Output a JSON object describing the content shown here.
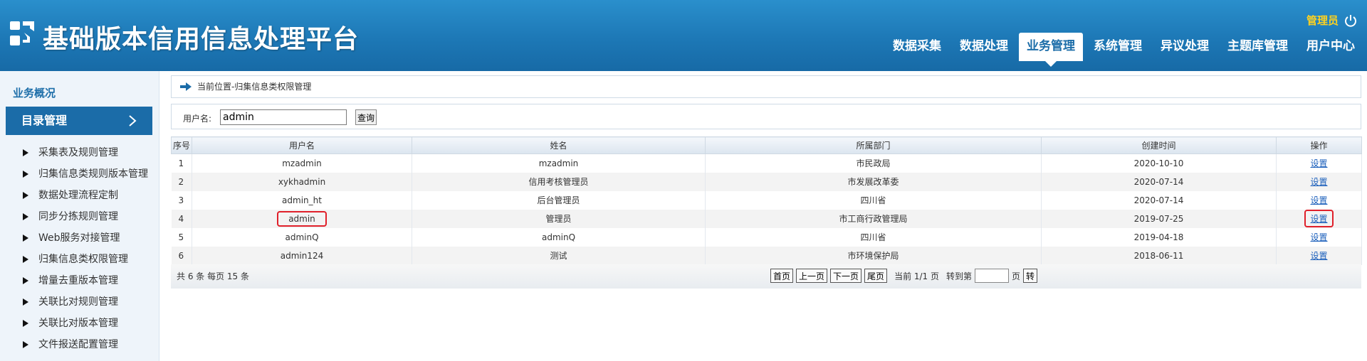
{
  "header": {
    "title": "基础版本信用信息处理平台",
    "user": "管理员",
    "nav": [
      "数据采集",
      "数据处理",
      "业务管理",
      "系统管理",
      "异议处理",
      "主题库管理",
      "用户中心"
    ],
    "active_nav": "业务管理"
  },
  "sidebar": {
    "overview": "业务概况",
    "active": "目录管理",
    "items": [
      "采集表及规则管理",
      "归集信息类规则版本管理",
      "数据处理流程定制",
      "同步分拣规则管理",
      "Web服务对接管理",
      "归集信息类权限管理",
      "增量去重版本管理",
      "关联比对规则管理",
      "关联比对版本管理",
      "文件报送配置管理"
    ]
  },
  "breadcrumb": "当前位置-归集信息类权限管理",
  "search": {
    "label": "用户名:",
    "value": "admin",
    "button": "查询"
  },
  "table": {
    "headers": [
      "序号",
      "用户名",
      "姓名",
      "所属部门",
      "创建时间",
      "操作"
    ],
    "rows": [
      [
        "1",
        "mzadmin",
        "mzadmin",
        "市民政局",
        "2020-10-10",
        "设置"
      ],
      [
        "2",
        "xykhadmin",
        "信用考核管理员",
        "市发展改革委",
        "2020-07-14",
        "设置"
      ],
      [
        "3",
        "admin_ht",
        "后台管理员",
        "四川省",
        "2020-07-14",
        "设置"
      ],
      [
        "4",
        "admin",
        "管理员",
        "市工商行政管理局",
        "2019-07-25",
        "设置"
      ],
      [
        "5",
        "adminQ",
        "adminQ",
        "四川省",
        "2019-04-18",
        "设置"
      ],
      [
        "6",
        "admin124",
        "测试",
        "市环境保护局",
        "2018-06-11",
        "设置"
      ]
    ]
  },
  "pager": {
    "summary": "共 6 条  每页  15  条",
    "first": "首页",
    "prev": "上一页",
    "next": "下一页",
    "last": "尾页",
    "current": "当前 1/1 页",
    "goto": "转到第",
    "page_unit": "页",
    "go": "转"
  },
  "colors": {
    "header": "#1d78b6",
    "accent": "#1b6ca8",
    "user": "#ffd21f",
    "highlight": "#e0202a"
  }
}
